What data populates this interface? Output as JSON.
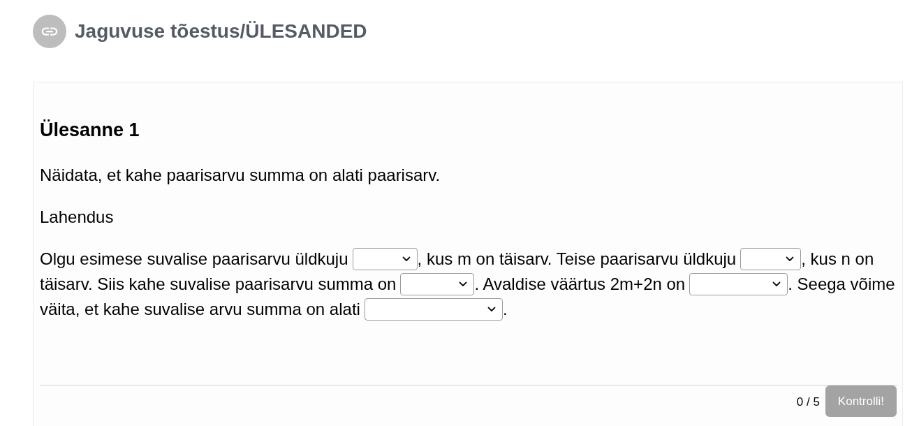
{
  "header": {
    "title": "Jaguvuse tõestus/ÜLESANDED"
  },
  "task": {
    "heading": "Ülesanne 1",
    "statement": "Näidata, et kahe paarisarvu summa on alati paarisarv.",
    "solution_label": "Lahendus",
    "solution_lines": [
      [
        {
          "kind": "text",
          "text": "Olgu esimese suvalise paarisarvu üldkuju"
        },
        {
          "kind": "dropdown"
        },
        {
          "kind": "text",
          "text": ", kus m on täisarv. Teise paarisarvu üldkuju"
        },
        {
          "kind": "dropdown"
        },
        {
          "kind": "text",
          "text": ", kus n on"
        }
      ],
      [
        {
          "kind": "text",
          "text": "täisarv. Siis kahe suvalise paarisarvu summa on"
        },
        {
          "kind": "dropdown"
        },
        {
          "kind": "text",
          "text": ". Avaldise väärtus 2m+2n on"
        },
        {
          "kind": "dropdown"
        },
        {
          "kind": "text",
          "text": ". Seega võime"
        }
      ],
      [
        {
          "kind": "text",
          "text": "väita, et kahe suvalise arvu summa on alati"
        },
        {
          "kind": "dropdown"
        },
        {
          "kind": "text",
          "text": "."
        }
      ]
    ]
  },
  "footer": {
    "score": "0 / 5",
    "check_button": {
      "label": "Kontrolli!",
      "disabled": true
    }
  }
}
